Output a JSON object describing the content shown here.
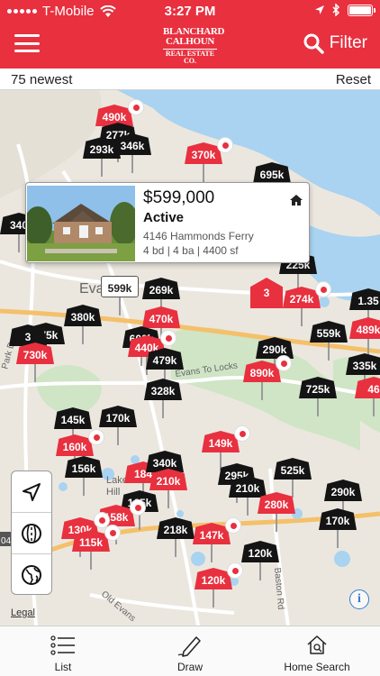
{
  "status_bar": {
    "carrier": "T-Mobile",
    "time": "3:27 PM"
  },
  "nav": {
    "brand_line1": "BLANCHARD",
    "brand_line2": "CALHOUN",
    "brand_line3": "REAL ESTATE CO.",
    "filter_label": "Filter"
  },
  "list_header": {
    "count_label": "75 newest",
    "reset_label": "Reset"
  },
  "callout": {
    "price": "$599,000",
    "status": "Active",
    "address": "4146 Hammonds Ferry",
    "specs": "4 bd | 4 ba | 4400 sf"
  },
  "map": {
    "place_label_evans": "Evans",
    "road_label_locks": "Evans To Locks",
    "road_label_baston": "Baston Rd",
    "road_label_old_evans": "Old Evans",
    "road_label_park": "Park Dr",
    "area_label_lakes": "Lakes",
    "area_label_hill": "Hill",
    "edge_label": "04",
    "legal": "Legal",
    "pins": [
      {
        "label": "490k",
        "kind": "red",
        "dot": true
      },
      {
        "label": "277k",
        "kind": "black"
      },
      {
        "label": "346k",
        "kind": "black"
      },
      {
        "label": "293k",
        "kind": "black"
      },
      {
        "label": "370k",
        "kind": "red",
        "dot": true
      },
      {
        "label": "695k",
        "kind": "black"
      },
      {
        "label": "340",
        "kind": "black"
      },
      {
        "label": "599k",
        "kind": "white"
      },
      {
        "label": "269k",
        "kind": "black"
      },
      {
        "label": "225k",
        "kind": "black"
      },
      {
        "label": "274k",
        "kind": "red",
        "dot": true
      },
      {
        "label": "1.35",
        "kind": "black"
      },
      {
        "label": "380k",
        "kind": "black"
      },
      {
        "label": "470k",
        "kind": "red"
      },
      {
        "label": "375k",
        "kind": "black"
      },
      {
        "label": "3",
        "kind": "black"
      },
      {
        "label": "730k",
        "kind": "red"
      },
      {
        "label": "600k",
        "kind": "black"
      },
      {
        "label": "440k",
        "kind": "red",
        "dot": true
      },
      {
        "label": "479k",
        "kind": "black"
      },
      {
        "label": "559k",
        "kind": "black"
      },
      {
        "label": "489k",
        "kind": "red"
      },
      {
        "label": "290k",
        "kind": "black"
      },
      {
        "label": "890k",
        "kind": "red",
        "dot": true
      },
      {
        "label": "335k",
        "kind": "black"
      },
      {
        "label": "328k",
        "kind": "black"
      },
      {
        "label": "725k",
        "kind": "black"
      },
      {
        "label": "46",
        "kind": "red"
      },
      {
        "label": "145k",
        "kind": "black"
      },
      {
        "label": "170k",
        "kind": "black"
      },
      {
        "label": "160k",
        "kind": "red",
        "dot": true
      },
      {
        "label": "149k",
        "kind": "red",
        "dot": true
      },
      {
        "label": "156k",
        "kind": "black"
      },
      {
        "label": "184",
        "kind": "red"
      },
      {
        "label": "340k",
        "kind": "black"
      },
      {
        "label": "210k",
        "kind": "red"
      },
      {
        "label": "295k",
        "kind": "black"
      },
      {
        "label": "525k",
        "kind": "black"
      },
      {
        "label": "210k",
        "kind": "black"
      },
      {
        "label": "280k",
        "kind": "red"
      },
      {
        "label": "290k",
        "kind": "black"
      },
      {
        "label": "165k",
        "kind": "black"
      },
      {
        "label": "158k",
        "kind": "red",
        "dot": true
      },
      {
        "label": "170k",
        "kind": "black"
      },
      {
        "label": "130k",
        "kind": "red",
        "dot": true
      },
      {
        "label": "115k",
        "kind": "red",
        "dot": true
      },
      {
        "label": "218k",
        "kind": "black"
      },
      {
        "label": "147k",
        "kind": "red",
        "dot": true
      },
      {
        "label": "120k",
        "kind": "black"
      },
      {
        "label": "120k",
        "kind": "red",
        "dot": true
      }
    ],
    "cluster_label": "3"
  },
  "tabs": [
    {
      "label": "List"
    },
    {
      "label": "Draw"
    },
    {
      "label": "Home Search"
    }
  ]
}
